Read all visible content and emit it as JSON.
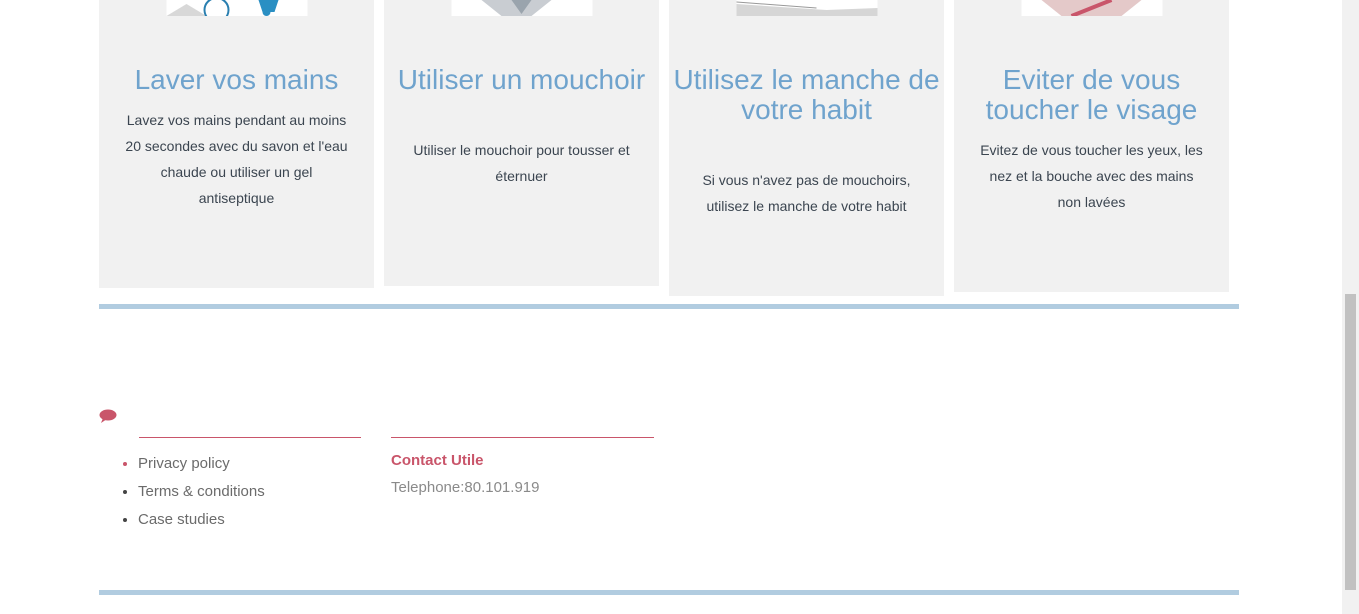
{
  "cards": [
    {
      "title": "Laver vos mains",
      "text": "Lavez vos mains pendant au moins 20 secondes avec du savon et l'eau chaude ou utiliser un gel antiseptique"
    },
    {
      "title": "Utiliser un mouchoir",
      "text": "Utiliser le mouchoir pour tousser et éternuer"
    },
    {
      "title": "Utilisez le manche de votre habit",
      "text": "Si vous n'avez pas de mouchoirs, utilisez le manche de votre habit"
    },
    {
      "title": "Eviter de vous toucher le visage",
      "text": "Evitez de vous toucher les yeux, les nez et la bouche avec des mains non lavées"
    }
  ],
  "footer": {
    "links": [
      "Privacy policy",
      "Terms & conditions",
      "Case studies"
    ],
    "contact_title": "Contact Utile",
    "contact_phone": "Telephone:80.101.919"
  },
  "colors": {
    "accent": "#6fa3cd",
    "brand_red": "#c9556a",
    "rule": "#b1cce0"
  }
}
